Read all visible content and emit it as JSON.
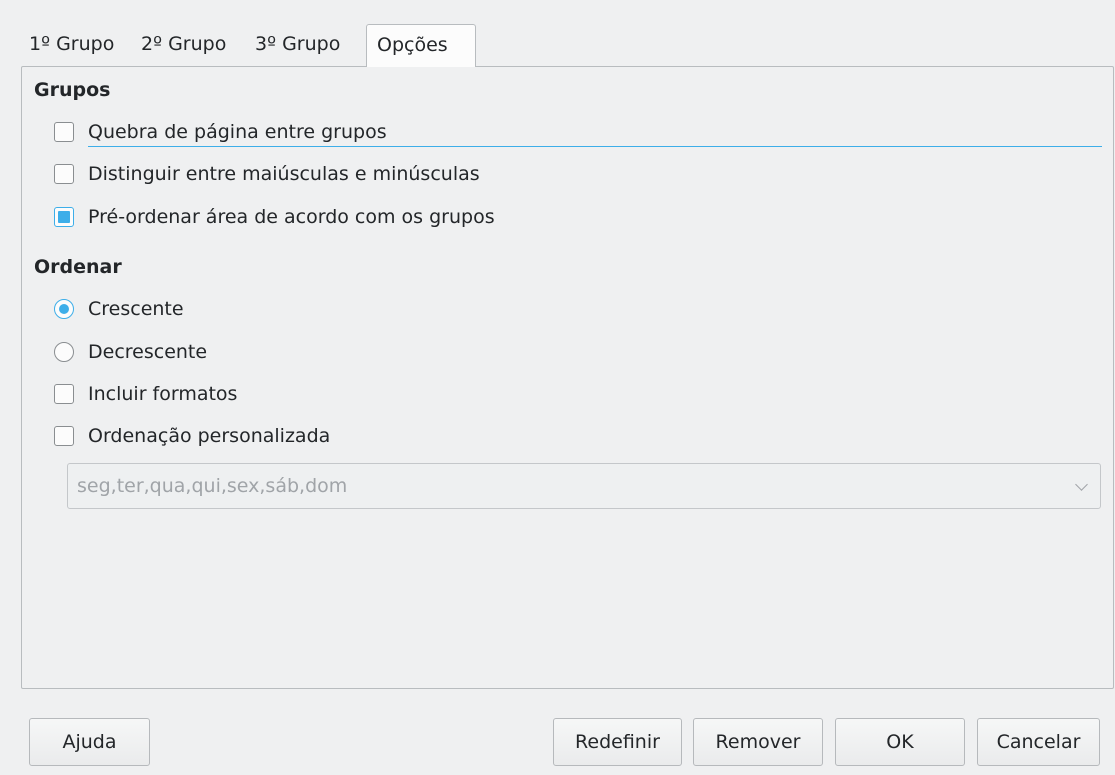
{
  "tabs": [
    "1º Grupo",
    "2º Grupo",
    "3º Grupo",
    "Opções"
  ],
  "active_tab": "Opções",
  "grupos": {
    "title": "Grupos",
    "page_break": {
      "label": "Quebra de página entre grupos",
      "checked": false
    },
    "case_sensitive": {
      "label": "Distinguir entre maiúsculas e minúsculas",
      "checked": false
    },
    "pre_sort": {
      "label": "Pré-ordenar área de acordo com os grupos",
      "checked": true
    }
  },
  "ordenar": {
    "title": "Ordenar",
    "ascending": {
      "label": "Crescente",
      "selected": true
    },
    "descending": {
      "label": "Decrescente",
      "selected": false
    },
    "include_formats": {
      "label": "Incluir formatos",
      "checked": false
    },
    "custom_order": {
      "label": "Ordenação personalizada",
      "checked": false
    },
    "custom_order_value": "seg,ter,qua,qui,sex,sáb,dom"
  },
  "buttons": {
    "help": "Ajuda",
    "reset": "Redefinir",
    "remove": "Remover",
    "ok": "OK",
    "cancel": "Cancelar"
  },
  "colors": {
    "accent": "#3daee9",
    "background": "#eff0f1"
  }
}
